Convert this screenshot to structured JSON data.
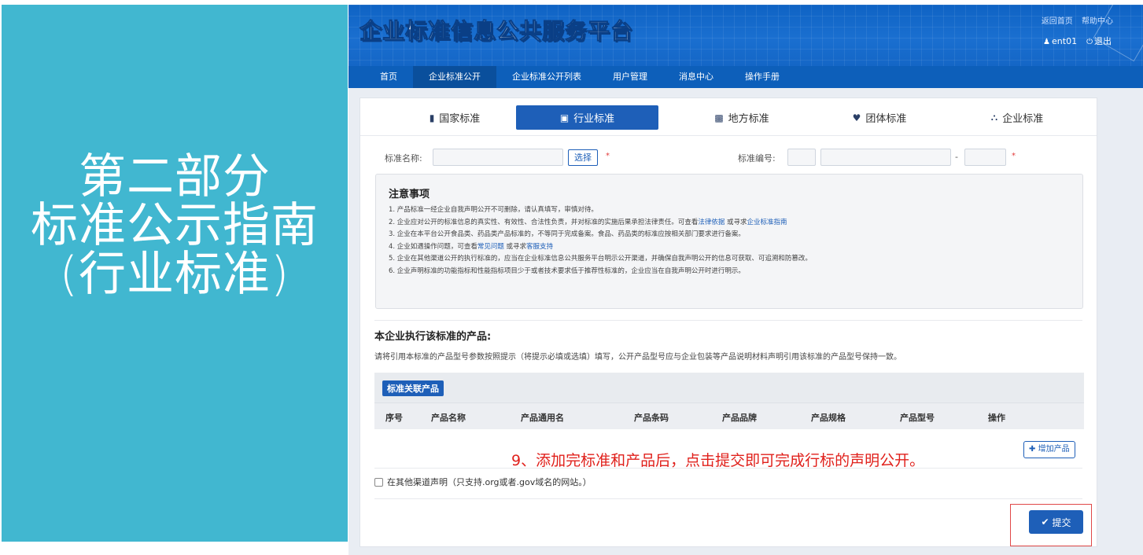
{
  "slide": {
    "title_lines": [
      "第二部分",
      "标准公示指南",
      "(行业标准)"
    ]
  },
  "colors": {
    "slide_panel": "#41b7d0",
    "header_blue": "#1466c6",
    "nav_blue": "#0d5fba",
    "primary": "#1e5fb8",
    "callout_red": "#e0201b"
  },
  "header": {
    "logo_text": "企业标准信息公共服务平台",
    "links": [
      "返回首页",
      "帮助中心"
    ],
    "user_icon": "user-icon",
    "username": "ent01",
    "logout_icon": "power-icon",
    "logout_label": "退出"
  },
  "nav": {
    "items": [
      "首页",
      "企业标准公开",
      "企业标准公开列表",
      "用户管理",
      "消息中心",
      "操作手册"
    ],
    "active": "企业标准公开"
  },
  "std_tabs": [
    {
      "label": "国家标准",
      "icon": "book-icon"
    },
    {
      "label": "行业标准",
      "icon": "briefcase-icon",
      "active": true
    },
    {
      "label": "地方标准",
      "icon": "file-icon"
    },
    {
      "label": "团体标准",
      "icon": "shield-icon"
    },
    {
      "label": "企业标准",
      "icon": "institution-icon"
    }
  ],
  "form": {
    "name_label": "标准名称:",
    "select_button": "选择",
    "required_mark": "*",
    "number_label": "标准编号:",
    "dash": "-"
  },
  "notice": {
    "title": "注意事项",
    "lines": [
      {
        "pre": "1. 产品标准一经企业自我声明公开不可删除，请认真填写，审慎对待。"
      },
      {
        "pre": "2. 企业应对公开的标准信息的真实性、有效性、合法性负责，并对标准的实施后果承担法律责任。可查看",
        "link1": "法律依据",
        "mid": " 或寻求",
        "link2": "企业标准指南",
        "post": ""
      },
      {
        "pre": "3. 企业在本平台公开食品类、药品类产品标准的，不等同于完成备案。食品、药品类的标准应按相关部门要求进行备案。"
      },
      {
        "pre": "4. 企业如遇操作问题，可查看",
        "link1": "常见问题",
        "mid": " 或寻求",
        "link2": "客服支持",
        "post": ""
      },
      {
        "pre": "5. 企业在其他渠道公开的执行标准的，应当在企业标准信息公共服务平台明示公开渠道，并确保自我声明公开的信息可获取、可追溯和防篡改。"
      },
      {
        "pre": "6. 企业声明标准的功能指标和性能指标项目少于或者技术要求低于推荐性标准的，企业应当在自我声明公开时进行明示。"
      }
    ]
  },
  "products": {
    "title": "本企业执行该标准的产品:",
    "note": "请将引用本标准的产品型号参数按照提示（将提示必填或选填）填写，公开产品型号应与企业包装等产品说明材料声明引用该标准的产品型号保持一致。",
    "badge": "标准关联产品",
    "columns": [
      "序号",
      "产品名称",
      "产品通用名",
      "产品条码",
      "产品品牌",
      "产品规格",
      "产品型号",
      "操作"
    ],
    "add_button": "增加产品",
    "add_icon": "plus-icon"
  },
  "callout": "9、添加完标准和产品后，点击提交即可完成行标的声明公开。",
  "other_channel": "在其他渠道声明（只支持.org或者.gov域名的网站。）",
  "submit": {
    "label": "提交",
    "icon": "check-icon"
  }
}
